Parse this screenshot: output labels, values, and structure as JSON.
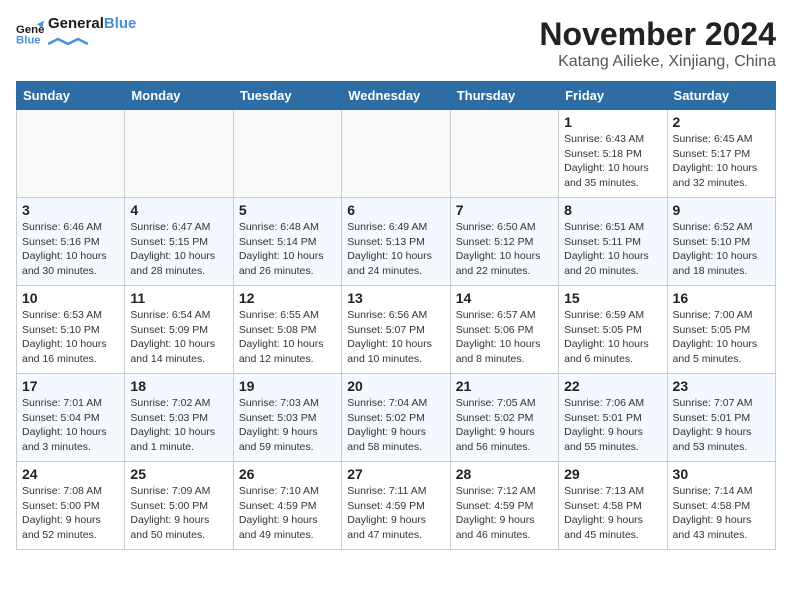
{
  "header": {
    "logo_line1": "General",
    "logo_line2": "Blue",
    "month": "November 2024",
    "location": "Katang Ailieke, Xinjiang, China"
  },
  "days_of_week": [
    "Sunday",
    "Monday",
    "Tuesday",
    "Wednesday",
    "Thursday",
    "Friday",
    "Saturday"
  ],
  "weeks": [
    [
      {
        "day": "",
        "info": ""
      },
      {
        "day": "",
        "info": ""
      },
      {
        "day": "",
        "info": ""
      },
      {
        "day": "",
        "info": ""
      },
      {
        "day": "",
        "info": ""
      },
      {
        "day": "1",
        "info": "Sunrise: 6:43 AM\nSunset: 5:18 PM\nDaylight: 10 hours and 35 minutes."
      },
      {
        "day": "2",
        "info": "Sunrise: 6:45 AM\nSunset: 5:17 PM\nDaylight: 10 hours and 32 minutes."
      }
    ],
    [
      {
        "day": "3",
        "info": "Sunrise: 6:46 AM\nSunset: 5:16 PM\nDaylight: 10 hours and 30 minutes."
      },
      {
        "day": "4",
        "info": "Sunrise: 6:47 AM\nSunset: 5:15 PM\nDaylight: 10 hours and 28 minutes."
      },
      {
        "day": "5",
        "info": "Sunrise: 6:48 AM\nSunset: 5:14 PM\nDaylight: 10 hours and 26 minutes."
      },
      {
        "day": "6",
        "info": "Sunrise: 6:49 AM\nSunset: 5:13 PM\nDaylight: 10 hours and 24 minutes."
      },
      {
        "day": "7",
        "info": "Sunrise: 6:50 AM\nSunset: 5:12 PM\nDaylight: 10 hours and 22 minutes."
      },
      {
        "day": "8",
        "info": "Sunrise: 6:51 AM\nSunset: 5:11 PM\nDaylight: 10 hours and 20 minutes."
      },
      {
        "day": "9",
        "info": "Sunrise: 6:52 AM\nSunset: 5:10 PM\nDaylight: 10 hours and 18 minutes."
      }
    ],
    [
      {
        "day": "10",
        "info": "Sunrise: 6:53 AM\nSunset: 5:10 PM\nDaylight: 10 hours and 16 minutes."
      },
      {
        "day": "11",
        "info": "Sunrise: 6:54 AM\nSunset: 5:09 PM\nDaylight: 10 hours and 14 minutes."
      },
      {
        "day": "12",
        "info": "Sunrise: 6:55 AM\nSunset: 5:08 PM\nDaylight: 10 hours and 12 minutes."
      },
      {
        "day": "13",
        "info": "Sunrise: 6:56 AM\nSunset: 5:07 PM\nDaylight: 10 hours and 10 minutes."
      },
      {
        "day": "14",
        "info": "Sunrise: 6:57 AM\nSunset: 5:06 PM\nDaylight: 10 hours and 8 minutes."
      },
      {
        "day": "15",
        "info": "Sunrise: 6:59 AM\nSunset: 5:05 PM\nDaylight: 10 hours and 6 minutes."
      },
      {
        "day": "16",
        "info": "Sunrise: 7:00 AM\nSunset: 5:05 PM\nDaylight: 10 hours and 5 minutes."
      }
    ],
    [
      {
        "day": "17",
        "info": "Sunrise: 7:01 AM\nSunset: 5:04 PM\nDaylight: 10 hours and 3 minutes."
      },
      {
        "day": "18",
        "info": "Sunrise: 7:02 AM\nSunset: 5:03 PM\nDaylight: 10 hours and 1 minute."
      },
      {
        "day": "19",
        "info": "Sunrise: 7:03 AM\nSunset: 5:03 PM\nDaylight: 9 hours and 59 minutes."
      },
      {
        "day": "20",
        "info": "Sunrise: 7:04 AM\nSunset: 5:02 PM\nDaylight: 9 hours and 58 minutes."
      },
      {
        "day": "21",
        "info": "Sunrise: 7:05 AM\nSunset: 5:02 PM\nDaylight: 9 hours and 56 minutes."
      },
      {
        "day": "22",
        "info": "Sunrise: 7:06 AM\nSunset: 5:01 PM\nDaylight: 9 hours and 55 minutes."
      },
      {
        "day": "23",
        "info": "Sunrise: 7:07 AM\nSunset: 5:01 PM\nDaylight: 9 hours and 53 minutes."
      }
    ],
    [
      {
        "day": "24",
        "info": "Sunrise: 7:08 AM\nSunset: 5:00 PM\nDaylight: 9 hours and 52 minutes."
      },
      {
        "day": "25",
        "info": "Sunrise: 7:09 AM\nSunset: 5:00 PM\nDaylight: 9 hours and 50 minutes."
      },
      {
        "day": "26",
        "info": "Sunrise: 7:10 AM\nSunset: 4:59 PM\nDaylight: 9 hours and 49 minutes."
      },
      {
        "day": "27",
        "info": "Sunrise: 7:11 AM\nSunset: 4:59 PM\nDaylight: 9 hours and 47 minutes."
      },
      {
        "day": "28",
        "info": "Sunrise: 7:12 AM\nSunset: 4:59 PM\nDaylight: 9 hours and 46 minutes."
      },
      {
        "day": "29",
        "info": "Sunrise: 7:13 AM\nSunset: 4:58 PM\nDaylight: 9 hours and 45 minutes."
      },
      {
        "day": "30",
        "info": "Sunrise: 7:14 AM\nSunset: 4:58 PM\nDaylight: 9 hours and 43 minutes."
      }
    ]
  ]
}
